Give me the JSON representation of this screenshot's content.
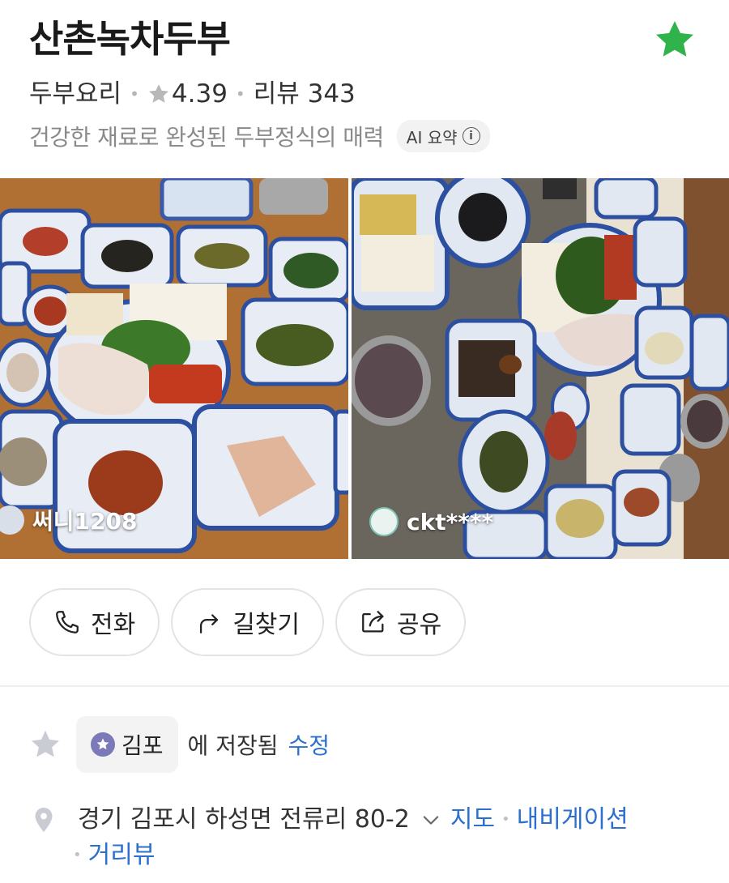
{
  "header": {
    "title": "산촌녹차두부",
    "category": "두부요리",
    "rating": "4.39",
    "review_label": "리뷰 343",
    "ai_summary": "건강한 재료로 완성된 두부정식의 매력",
    "ai_badge": "AI 요약",
    "ai_info_glyph": "i"
  },
  "colors": {
    "favorite_star": "#2fb34a",
    "link": "#2b6fcf",
    "folder_icon": "#7b79b8"
  },
  "photos": [
    {
      "user": "써니1208"
    },
    {
      "user": "ckt****"
    }
  ],
  "actions": {
    "call": "전화",
    "directions": "길찾기",
    "share": "공유"
  },
  "saved": {
    "folder": "김포",
    "text": "에 저장됨",
    "edit": "수정"
  },
  "address": {
    "text": "경기 김포시 하성면 전류리 80-2",
    "map": "지도",
    "navigation": "내비게이션",
    "street_view": "거리뷰"
  }
}
